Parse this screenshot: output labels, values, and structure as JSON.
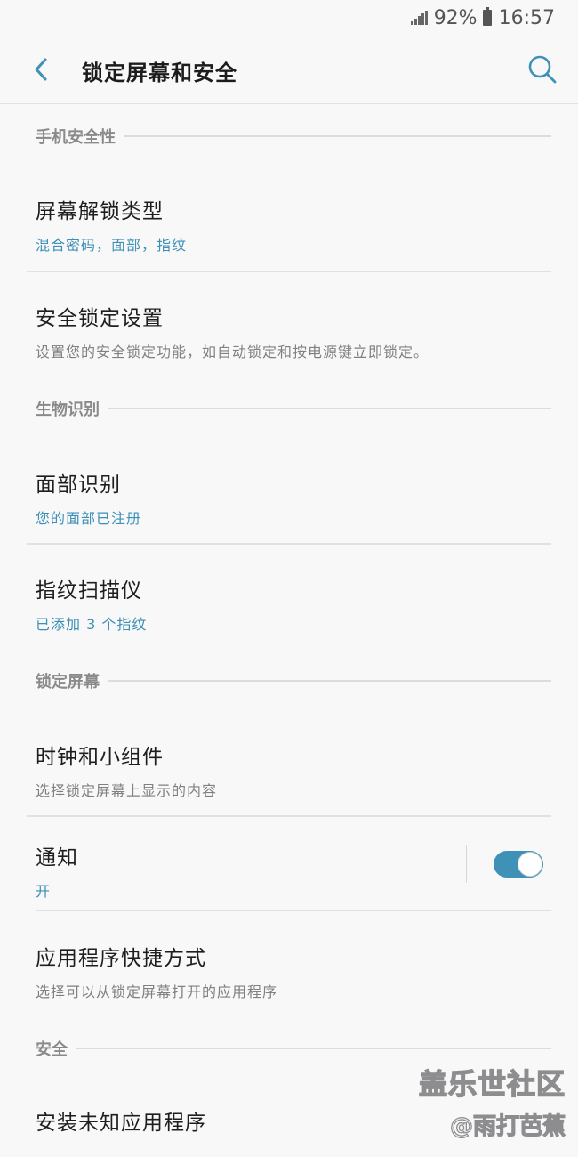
{
  "status_bar": {
    "battery_percent": "92%",
    "time": "16:57",
    "signal_icon": "signal-icon",
    "battery_icon": "battery-icon"
  },
  "header": {
    "title": "锁定屏幕和安全",
    "back_icon": "chevron-left-icon",
    "search_icon": "search-icon",
    "accent_color": "#3f91b8"
  },
  "sections": {
    "phone_security": "手机安全性",
    "biometrics": "生物识别",
    "lock_screen": "锁定屏幕",
    "security": "安全"
  },
  "items": {
    "screen_lock_type": {
      "title": "屏幕解锁类型",
      "subtitle": "混合密码，面部，指纹"
    },
    "secure_lock_settings": {
      "title": "安全锁定设置",
      "subtitle": "设置您的安全锁定功能，如自动锁定和按电源键立即锁定。"
    },
    "face_recognition": {
      "title": "面部识别",
      "subtitle": "您的面部已注册"
    },
    "fingerprint_scanner": {
      "title": "指纹扫描仪",
      "subtitle": "已添加 3 个指纹"
    },
    "clock_widgets": {
      "title": "时钟和小组件",
      "subtitle": "选择锁定屏幕上显示的内容"
    },
    "notifications": {
      "title": "通知",
      "subtitle": "开",
      "toggle_on": true
    },
    "app_shortcuts": {
      "title": "应用程序快捷方式",
      "subtitle": "选择可以从锁定屏幕打开的应用程序"
    },
    "install_unknown_apps": {
      "title": "安装未知应用程序"
    }
  },
  "watermark": {
    "brand": "盖乐世社区",
    "user": "@雨打芭蕉"
  }
}
